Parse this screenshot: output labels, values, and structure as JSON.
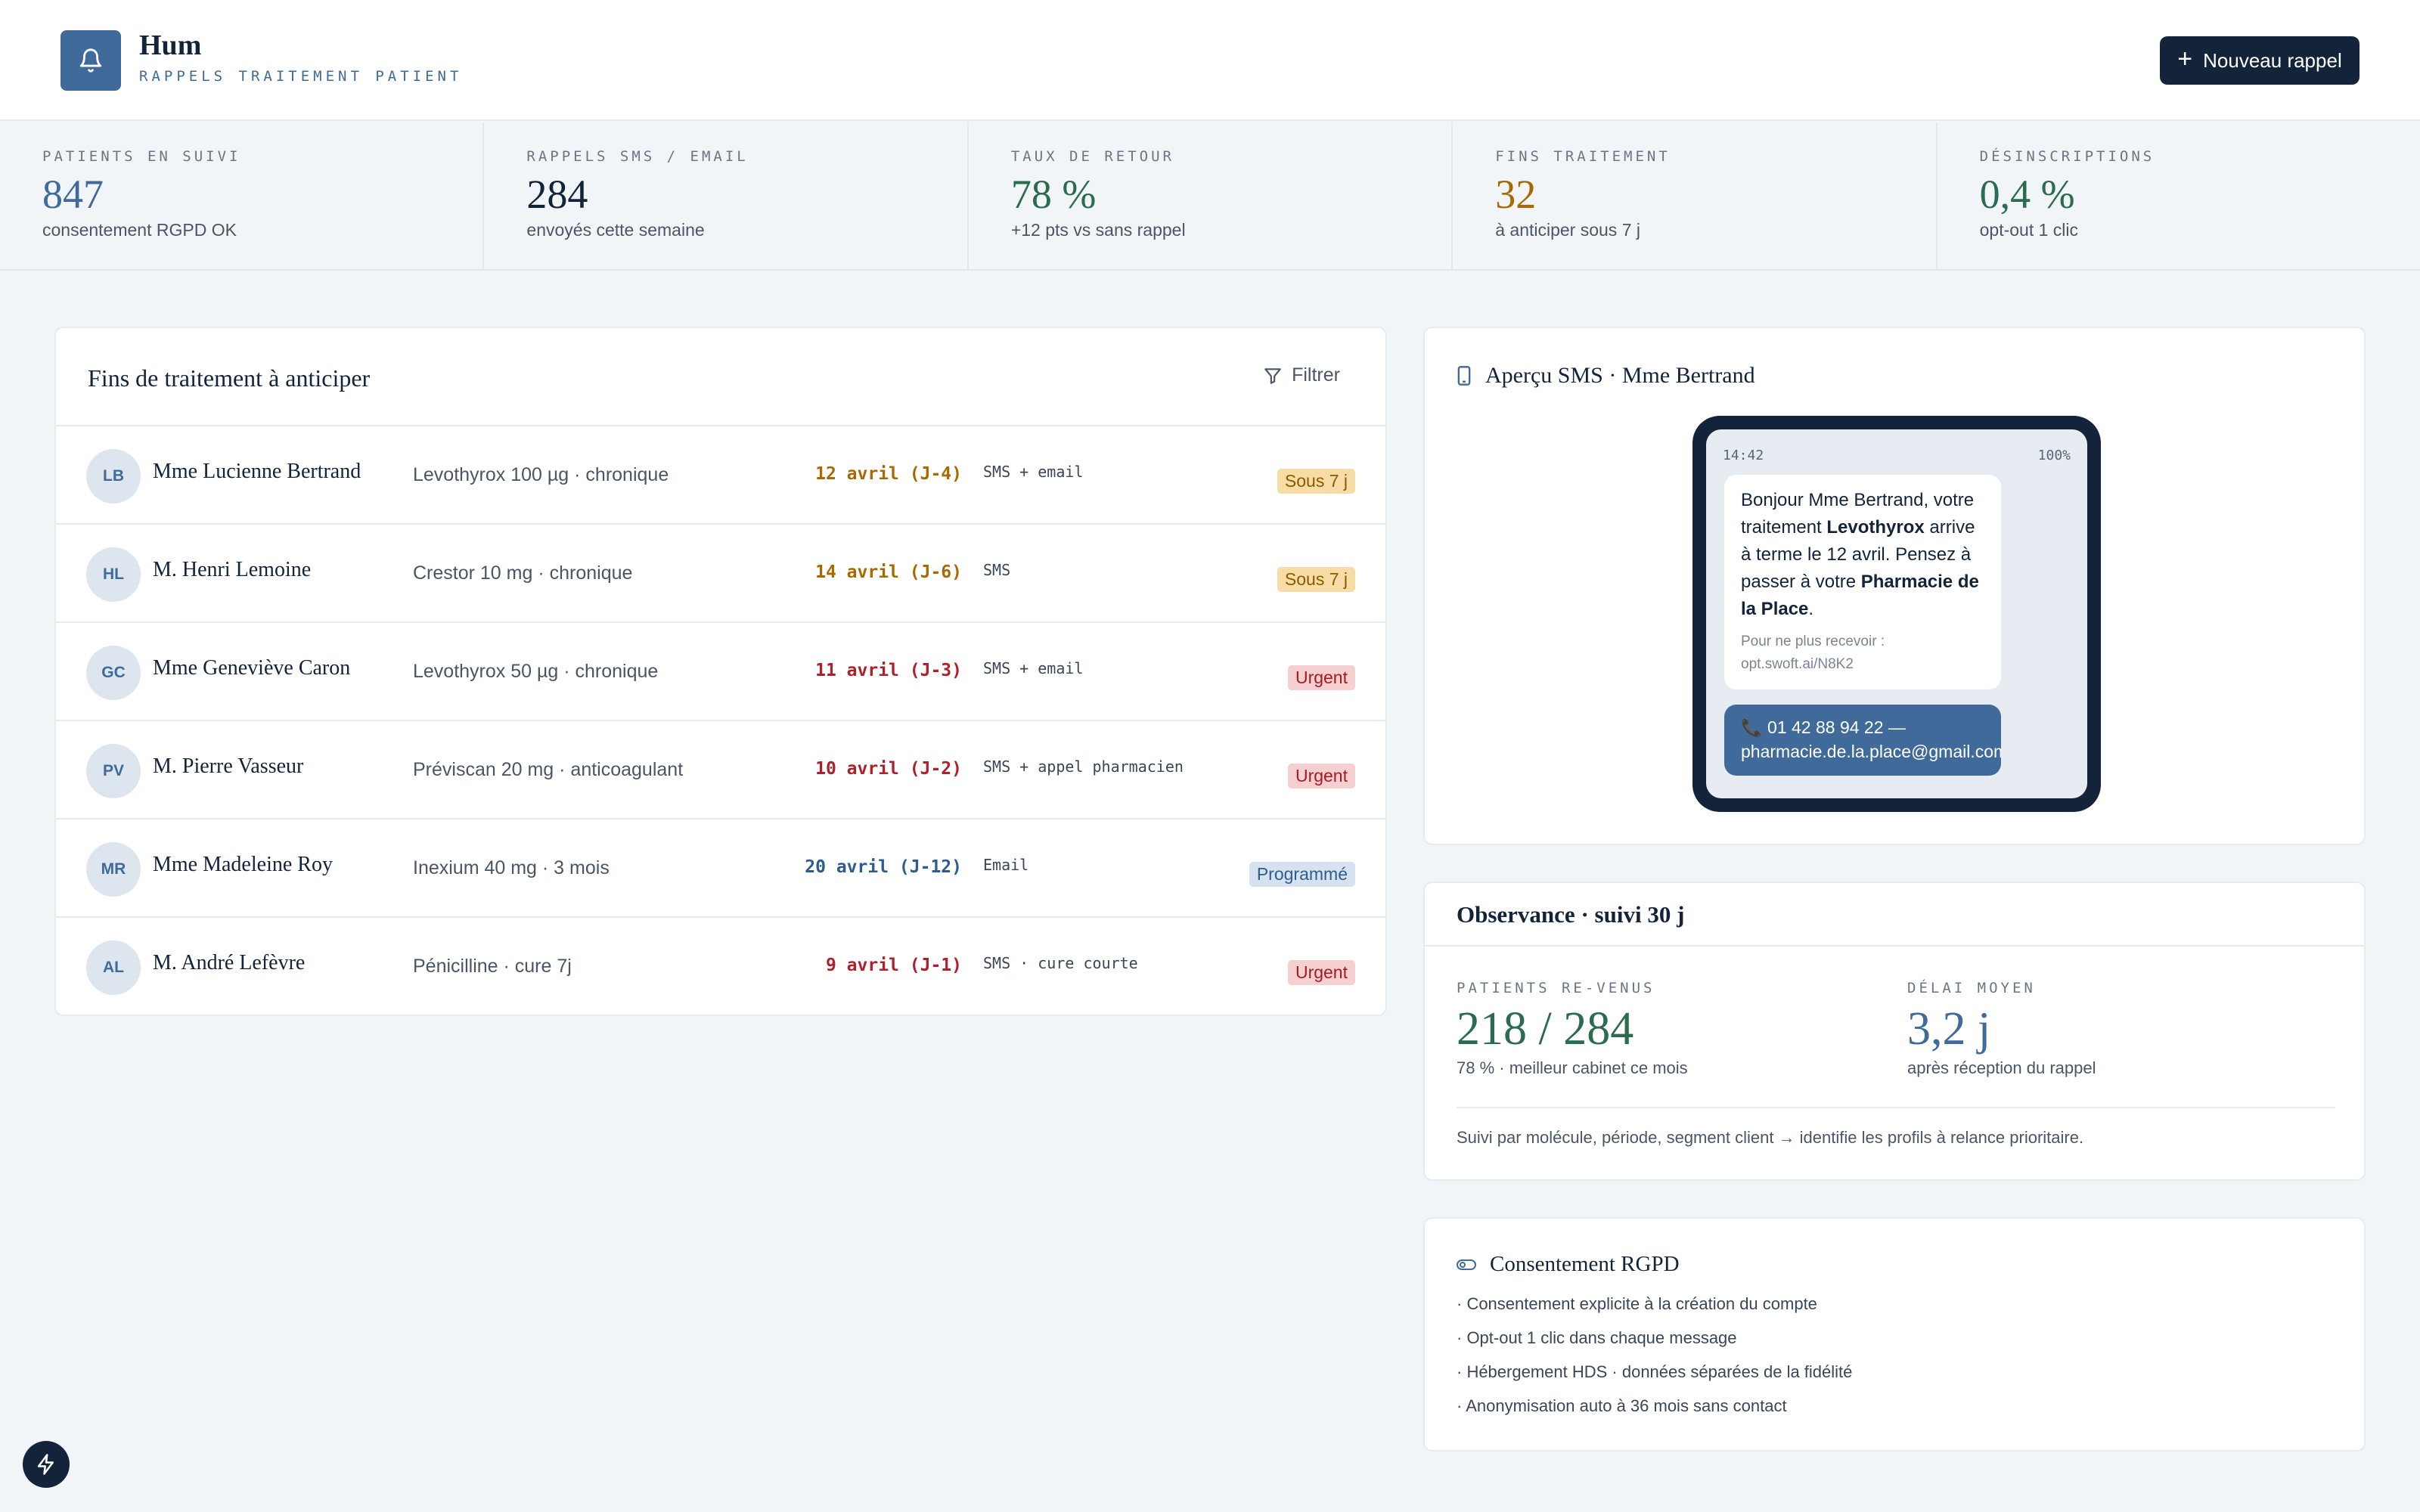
{
  "header": {
    "app_name": "Hum",
    "subtitle": "RAPPELS TRAITEMENT PATIENT",
    "new_button": "Nouveau rappel",
    "bell_icon": "bell-icon",
    "plus_icon": "plus-icon"
  },
  "stats": [
    {
      "label": "PATIENTS EN SUIVI",
      "value": "847",
      "sub": "consentement RGPD OK",
      "color": "#3f6a9a"
    },
    {
      "label": "RAPPELS SMS / EMAIL",
      "value": "284",
      "sub": "envoyés cette semaine",
      "color": "#13233a"
    },
    {
      "label": "TAUX DE RETOUR",
      "value": "78 %",
      "sub": "+12 pts vs sans rappel",
      "color": "#2b6b50"
    },
    {
      "label": "FINS TRAITEMENT",
      "value": "32",
      "sub": "à anticiper sous 7 j",
      "color": "#a86a00"
    },
    {
      "label": "DÉSINSCRIPTIONS",
      "value": "0,4 %",
      "sub": "opt-out 1 clic",
      "color": "#2b6b50"
    }
  ],
  "treatments": {
    "title": "Fins de traitement à anticiper",
    "filter_label": "Filtrer",
    "rows": [
      {
        "initials": "LB",
        "name": "Mme Lucienne Bertrand",
        "med": "Levothyrox 100 µg · chronique",
        "date": "12 avril (J-4)",
        "channel": "SMS + email",
        "badge": "Sous 7 j",
        "tone": "amber"
      },
      {
        "initials": "HL",
        "name": "M. Henri Lemoine",
        "med": "Crestor 10 mg · chronique",
        "date": "14 avril (J-6)",
        "channel": "SMS",
        "badge": "Sous 7 j",
        "tone": "amber"
      },
      {
        "initials": "GC",
        "name": "Mme Geneviève Caron",
        "med": "Levothyrox 50 µg · chronique",
        "date": "11 avril (J-3)",
        "channel": "SMS + email",
        "badge": "Urgent",
        "tone": "red"
      },
      {
        "initials": "PV",
        "name": "M. Pierre Vasseur",
        "med": "Préviscan 20 mg · anticoagulant",
        "date": "10 avril (J-2)",
        "channel": "SMS + appel pharmacien",
        "badge": "Urgent",
        "tone": "red"
      },
      {
        "initials": "MR",
        "name": "Mme Madeleine Roy",
        "med": "Inexium 40 mg · 3 mois",
        "date": "20 avril (J-12)",
        "channel": "Email",
        "badge": "Programmé",
        "tone": "blue"
      },
      {
        "initials": "AL",
        "name": "M. André Lefèvre",
        "med": "Pénicilline · cure 7j",
        "date": "9 avril (J-1)",
        "channel": "SMS · cure courte",
        "badge": "Urgent",
        "tone": "red"
      }
    ]
  },
  "sms_preview": {
    "title": "Aperçu SMS · Mme Bertrand",
    "time": "14:42",
    "battery": "100%",
    "msg_1": "Bonjour Mme Bertrand, votre traitement ",
    "msg_bold_1": "Levothyrox",
    "msg_2": " arrive à terme le 12 avril. Pensez à passer à votre ",
    "msg_bold_2": "Pharmacie de la Place",
    "msg_3": ".",
    "optout": "Pour ne plus recevoir : opt.swoft.ai/N8K2",
    "contact_phone": "01 42 88 94 22 —",
    "contact_email": "pharmacie.de.la.place@gmail.com"
  },
  "observance": {
    "title": "Observance · suivi 30 j",
    "left_label": "PATIENTS RE-VENUS",
    "left_value": "218 / 284",
    "left_sub": "78 % · meilleur cabinet ce mois",
    "right_label": "DÉLAI MOYEN",
    "right_value": "3,2 j",
    "right_sub": "après réception du rappel",
    "footer": "Suivi par molécule, période, segment client → identifie les profils à relance prioritaire."
  },
  "rgpd": {
    "title": "Consentement RGPD",
    "items": [
      "· Consentement explicite à la création du compte",
      "· Opt-out 1 clic dans chaque message",
      "· Hébergement HDS · données séparées de la fidélité",
      "· Anonymisation auto à 36 mois sans contact"
    ]
  }
}
